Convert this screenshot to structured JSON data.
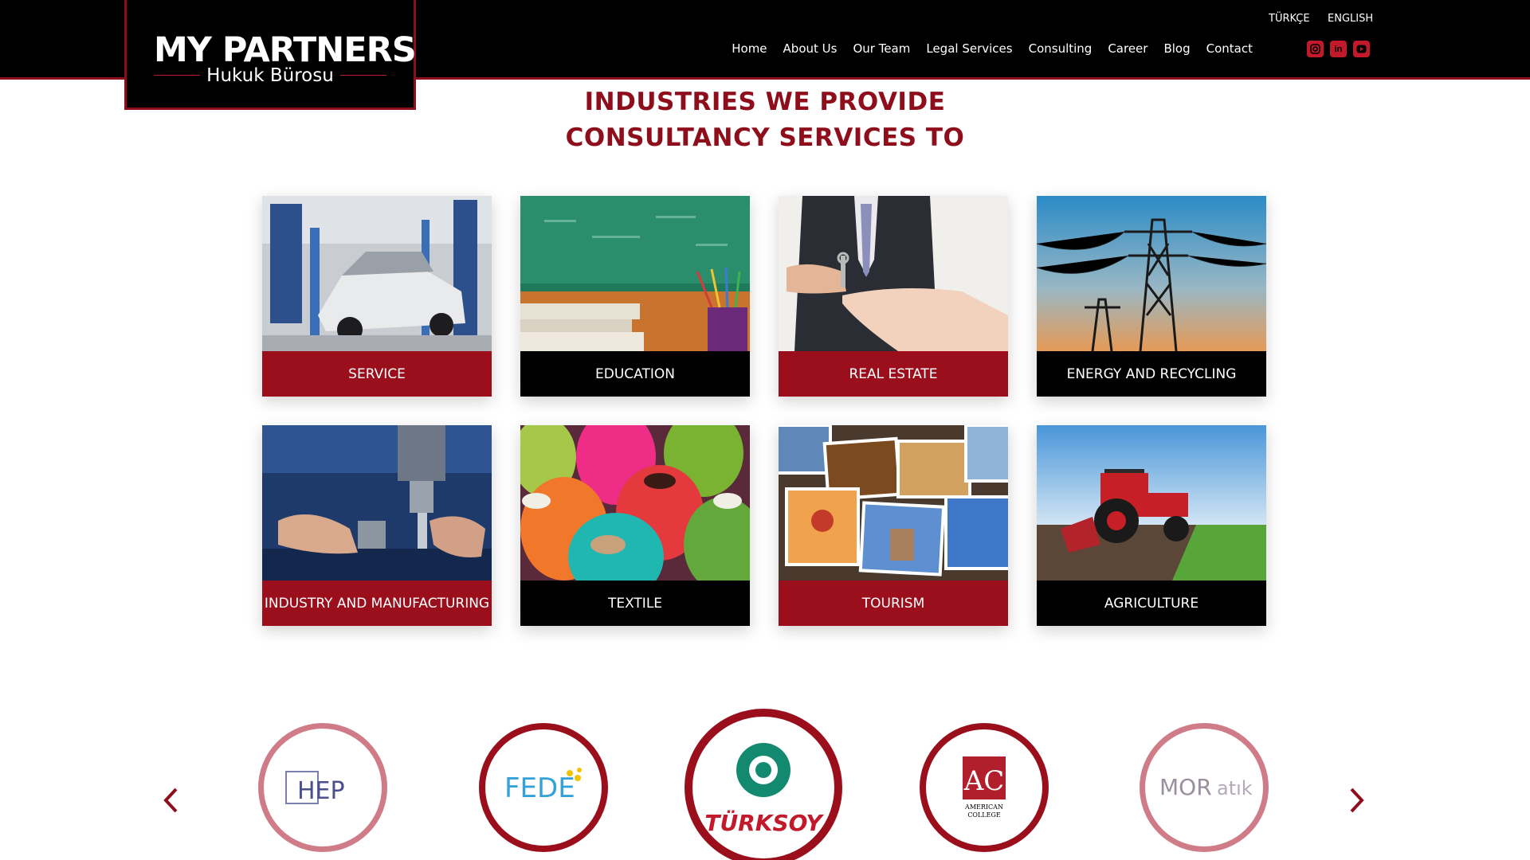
{
  "header": {
    "brand": "MY PARTNERS",
    "brand_sub": "Hukuk Bürosu",
    "languages": [
      "TÜRKÇE",
      "ENGLISH"
    ],
    "nav": [
      "Home",
      "About Us",
      "Our Team",
      "Legal Services",
      "Consulting",
      "Career",
      "Blog",
      "Contact"
    ],
    "social": [
      {
        "icon": "instagram-icon",
        "glyph": "◘"
      },
      {
        "icon": "linkedin-icon",
        "glyph": "in"
      },
      {
        "icon": "youtube-icon",
        "glyph": "▶"
      }
    ]
  },
  "section": {
    "title_line1": "INDUSTRIES WE PROVIDE",
    "title_line2": "CONSULTANCY SERVICES TO"
  },
  "industries": [
    {
      "label": "SERVICE",
      "image": "car-service-workshop-image"
    },
    {
      "label": "EDUCATION",
      "image": "books-chalkboard-image"
    },
    {
      "label": "REAL ESTATE",
      "image": "key-handover-image"
    },
    {
      "label": "ENERGY AND RECYCLING",
      "image": "power-lines-image"
    },
    {
      "label": "INDUSTRY AND MANUFACTURING",
      "image": "machinist-drilling-image"
    },
    {
      "label": "TEXTILE",
      "image": "yarn-spools-image"
    },
    {
      "label": "TOURISM",
      "image": "travel-photos-image"
    },
    {
      "label": "AGRICULTURE",
      "image": "tractor-field-image"
    }
  ],
  "partners": [
    {
      "name": "HEP",
      "logo": "hep-logo"
    },
    {
      "name": "FEDE",
      "logo": "fede-logo"
    },
    {
      "name": "TÜRKSOY",
      "logo": "turksoy-logo"
    },
    {
      "name": "AMERICAN COLLEGE",
      "logo": "american-college-logo"
    },
    {
      "name": "MOR atık",
      "logo": "mor-atik-logo"
    }
  ],
  "colors": {
    "accent": "#9b0f1c",
    "header_bg": "#000000",
    "light_ring": "#cf7c88"
  }
}
